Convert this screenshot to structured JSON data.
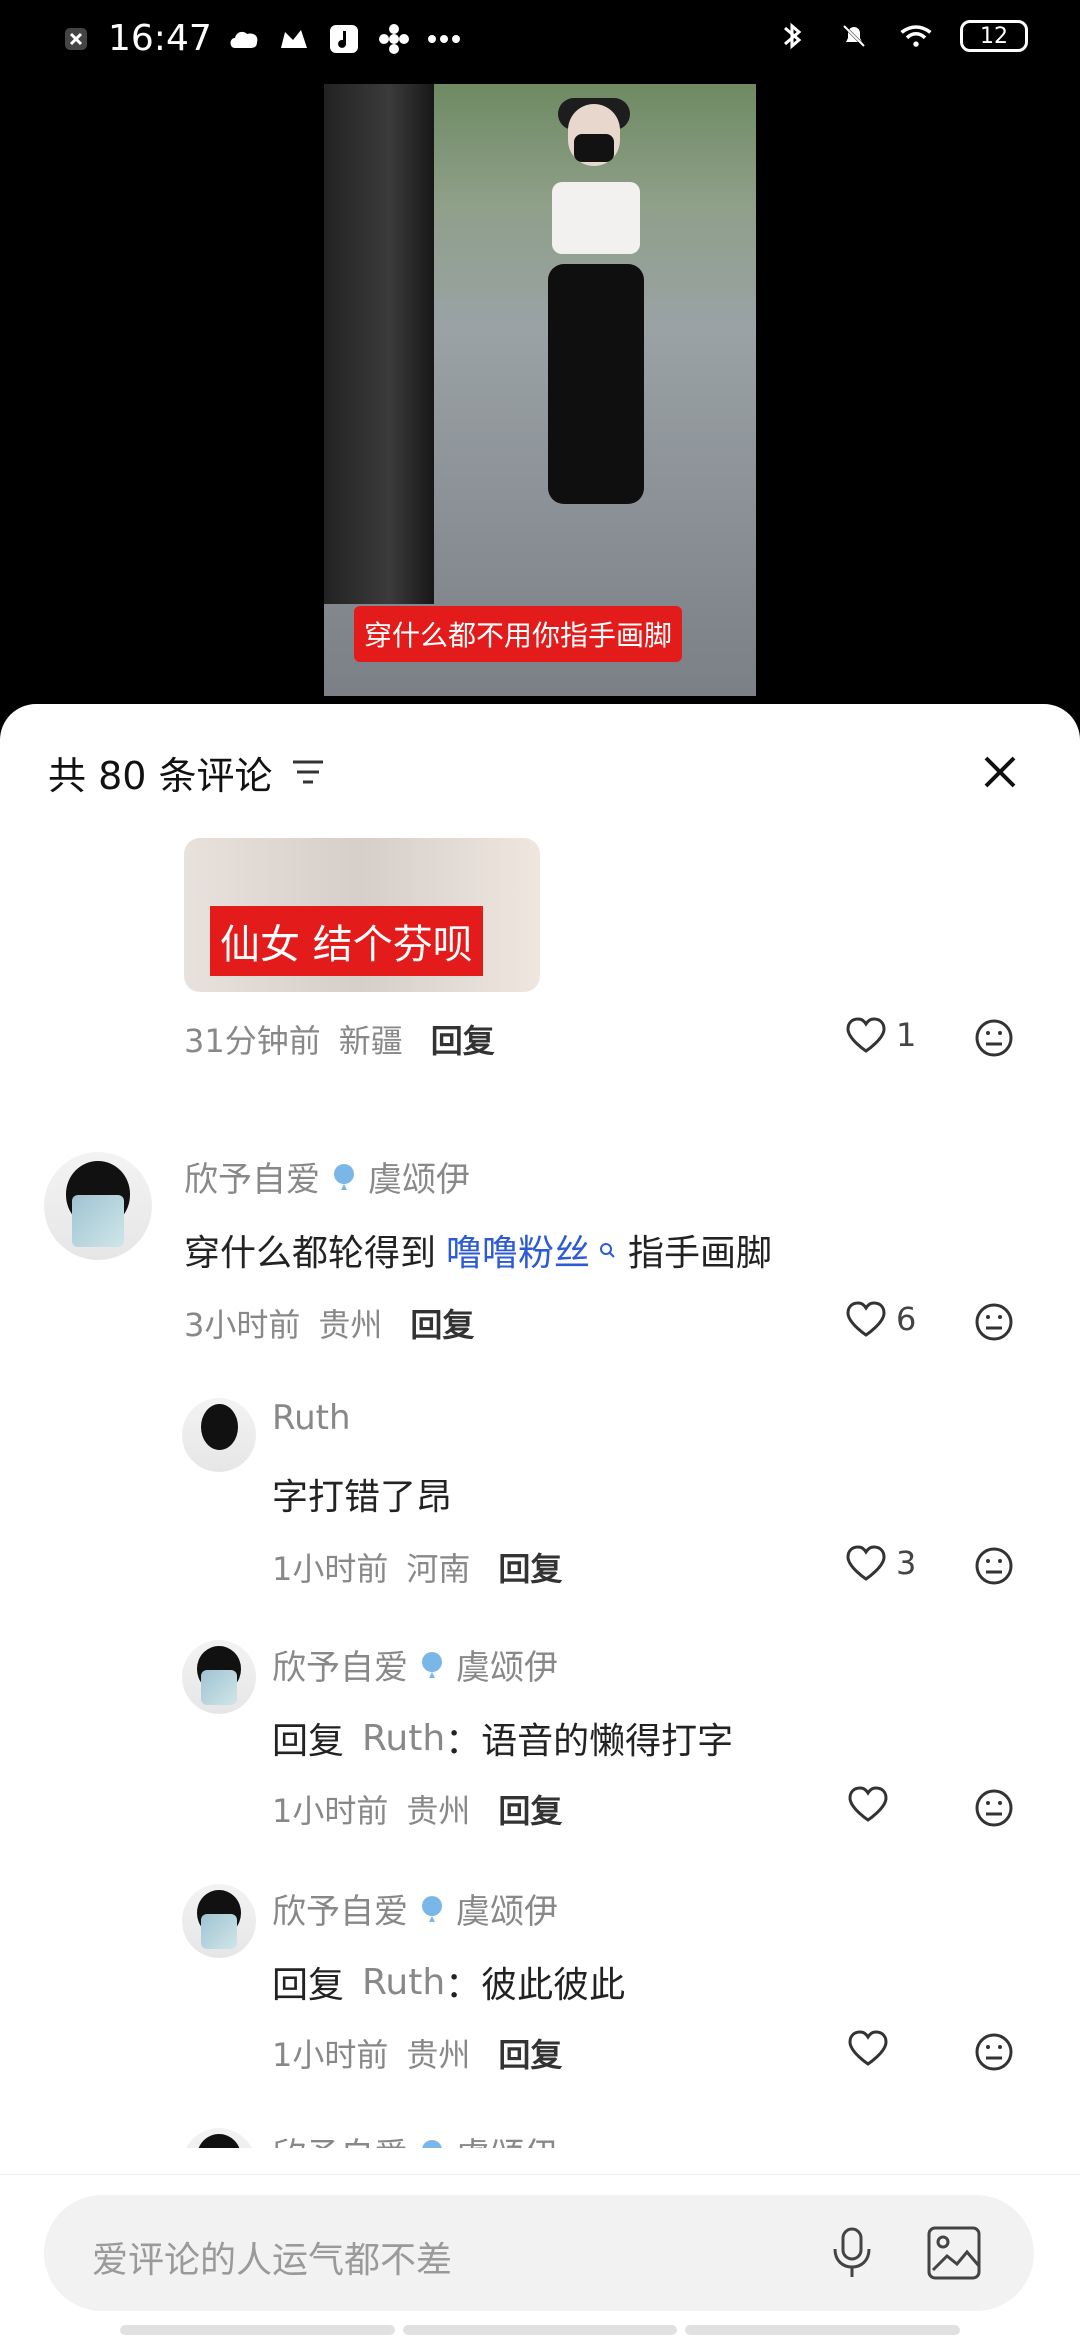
{
  "status": {
    "time": "16:47",
    "icons": [
      "sim-off-icon",
      "cloud-icon",
      "crown-icon",
      "music-icon",
      "flower-icon",
      "more-dots-icon"
    ],
    "battery": "12"
  },
  "video": {
    "caption": "穿什么都不用你指手画脚"
  },
  "sheet": {
    "title": "共 80 条评论"
  },
  "comments": {
    "first_reply": {
      "image_tag": "仙女 结个芬呗",
      "time": "31分钟前",
      "location": "新疆",
      "reply_label": "回复",
      "likes": "1"
    },
    "c1": {
      "username": "欣予自爱",
      "username2": "虞颂伊",
      "text_before": "穿什么都轮得到",
      "mention": "噜噜粉丝",
      "text_after": "指手画脚",
      "time": "3小时前",
      "location": "贵州",
      "reply_label": "回复",
      "likes": "6"
    },
    "r1": {
      "username": "Ruth",
      "text": "字打错了昂",
      "time": "1小时前",
      "location": "河南",
      "reply_label": "回复",
      "likes": "3"
    },
    "r2": {
      "username": "欣予自爱",
      "username2": "虞颂伊",
      "prefix": "回复",
      "target": "Ruth",
      "text": "：语音的懒得打字",
      "time": "1小时前",
      "location": "贵州",
      "reply_label": "回复"
    },
    "r3": {
      "username": "欣予自爱",
      "username2": "虞颂伊",
      "prefix": "回复",
      "target": "Ruth",
      "text": "：彼此彼此",
      "time": "1小时前",
      "location": "贵州",
      "reply_label": "回复"
    },
    "r4": {
      "username": "欣予自爱",
      "username2": "虞颂伊"
    }
  },
  "input": {
    "placeholder": "爱评论的人运气都不差"
  }
}
